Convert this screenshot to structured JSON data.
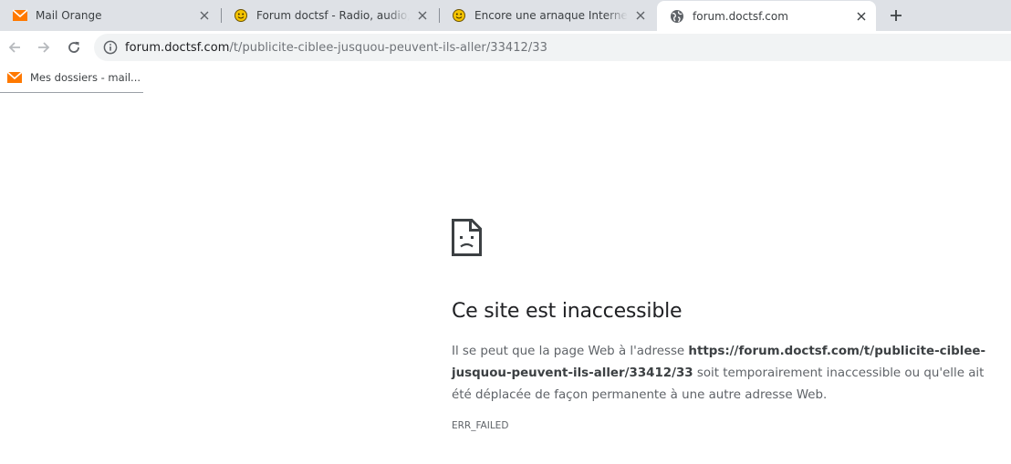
{
  "tabs": [
    {
      "title": "Mail Orange",
      "favicon": "orange-mail-icon",
      "active": false
    },
    {
      "title": "Forum doctsf - Radio, audio, TV, ",
      "favicon": "smiley-icon",
      "active": false
    },
    {
      "title": "Encore une arnaque Internet - Sal",
      "favicon": "smiley-icon",
      "active": false
    },
    {
      "title": "forum.doctsf.com",
      "favicon": "globe-icon",
      "active": true
    }
  ],
  "toolbar": {
    "back_icon": "back-arrow-icon",
    "forward_icon": "forward-arrow-icon",
    "reload_icon": "reload-icon",
    "url_host": "forum.doctsf.com",
    "url_path": "/t/publicite-ciblee-jusquou-peuvent-ils-aller/33412/33"
  },
  "bookmarks": [
    {
      "label": "Mes dossiers - mail...",
      "icon": "orange-mail-icon"
    }
  ],
  "error_page": {
    "title": "Ce site est inaccessible",
    "desc_before": "Il se peut que la page Web à l'adresse ",
    "desc_url": "https://forum.doctsf.com/t/publicite-ciblee-jusquou-peuvent-ils-aller/33412/33",
    "desc_after": " soit temporairement inaccessible ou qu'elle ait été déplacée de façon permanente à une autre adresse Web.",
    "code": "ERR_FAILED"
  },
  "colors": {
    "tabstrip_bg": "#dee1e6",
    "omnibox_bg": "#f1f3f4",
    "orange_brand": "#ff7900",
    "smiley_yellow": "#f5c400"
  }
}
